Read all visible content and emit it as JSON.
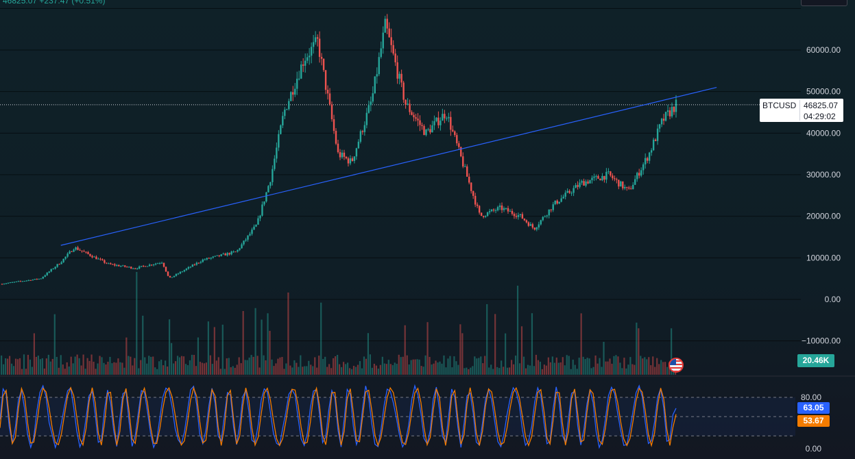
{
  "header": {
    "top_left_partial": "46825.07  +237.47 (+0.51%)",
    "currency_button": "USD"
  },
  "price_axis": {
    "ticks": [
      "60000.00",
      "50000.00",
      "40000.00",
      "30000.00",
      "20000.00",
      "10000.00",
      "0.00",
      "−10000.00"
    ],
    "current_symbol": "BTCUSD",
    "current_price": "46825.07",
    "countdown": "04:29:02"
  },
  "volume": {
    "last_label": "20.46K"
  },
  "oscillator": {
    "ticks": [
      "80.00",
      "0.00"
    ],
    "value_k": "63.05",
    "value_d": "53.67"
  },
  "colors": {
    "up": "#26a69a",
    "down": "#ef5350",
    "trendline": "#2962ff",
    "osc_k": "#2962ff",
    "osc_d": "#f57c00"
  },
  "chart_data": [
    {
      "type": "candlestick",
      "symbol": "BTCUSD",
      "x": [
        2019.0,
        2019.3,
        2019.45,
        2019.55,
        2019.8,
        2020.0,
        2020.2,
        2020.25,
        2020.5,
        2020.75,
        2020.9,
        2021.0,
        2021.1,
        2021.25,
        2021.35,
        2021.5,
        2021.6,
        2021.75,
        2021.85,
        2022.0,
        2022.15,
        2022.3,
        2022.45,
        2022.55,
        2022.7,
        2022.85,
        2022.95,
        2023.1,
        2023.3,
        2023.5,
        2023.65,
        2023.8,
        2023.9,
        2024.0
      ],
      "close": [
        3700,
        5000,
        9000,
        12500,
        8500,
        7500,
        9000,
        5000,
        9500,
        11500,
        18000,
        29000,
        45000,
        58000,
        62000,
        35000,
        33000,
        48000,
        66000,
        47000,
        40000,
        45000,
        30000,
        20000,
        22000,
        20000,
        17000,
        23000,
        28000,
        30000,
        26000,
        35000,
        43000,
        46825
      ],
      "ylim": [
        -15000,
        70000
      ],
      "trendline": {
        "from": [
          2019.45,
          13000
        ],
        "to": [
          2024.3,
          51000
        ]
      },
      "current": 46825.07
    },
    {
      "type": "bar",
      "name": "Volume",
      "last": 20460
    },
    {
      "type": "line",
      "name": "Stochastic RSI",
      "series": [
        {
          "role": "K",
          "last": 63.05
        },
        {
          "role": "D",
          "last": 53.67
        }
      ],
      "bands": [
        20,
        50,
        80
      ],
      "ylim": [
        0,
        100
      ]
    }
  ]
}
